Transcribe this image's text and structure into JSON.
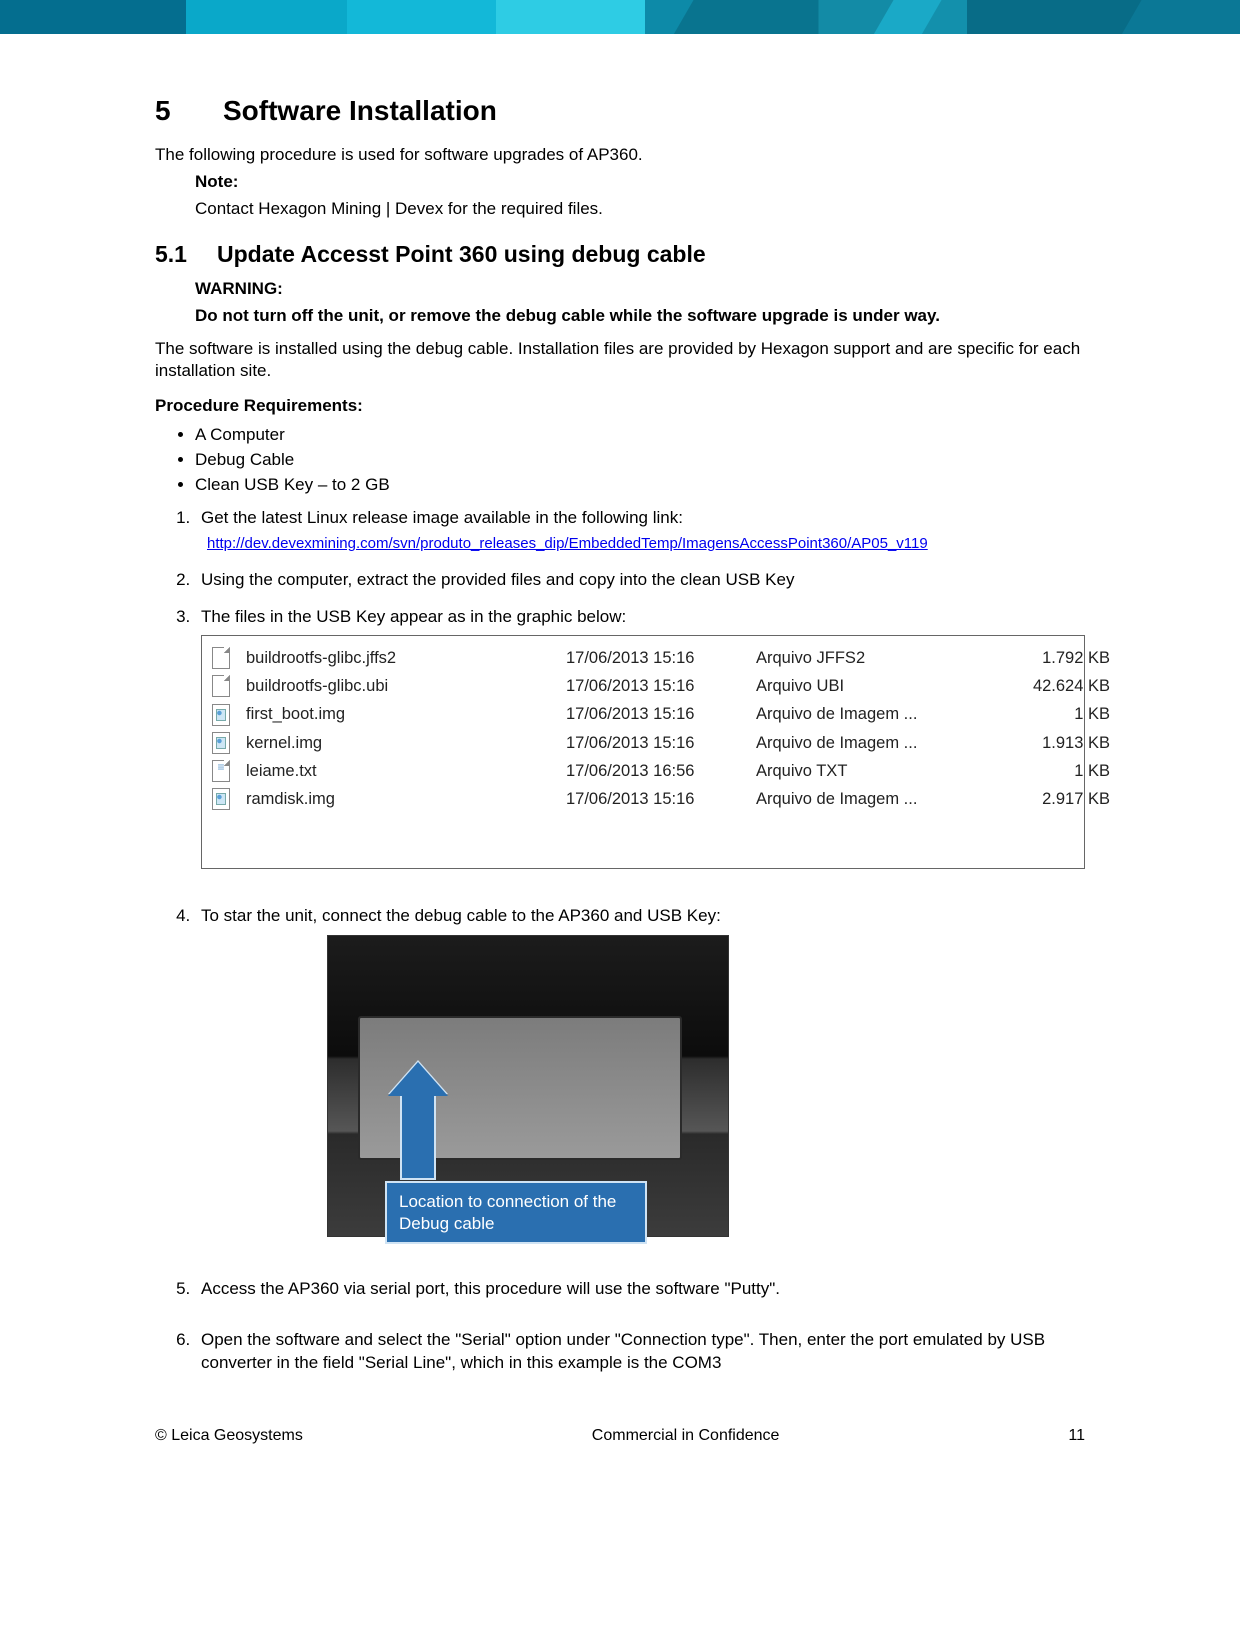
{
  "heading": {
    "num": "5",
    "title": "Software Installation"
  },
  "intro": "The following procedure is used for software upgrades of AP360.",
  "note": {
    "label": "Note:",
    "text": "Contact Hexagon Mining | Devex for the required files."
  },
  "subheading": {
    "num": "5.1",
    "title": "Update Accesst Point 360 using debug cable"
  },
  "warning": {
    "label": "WARNING:",
    "text": "Do not turn off the unit, or remove the debug cable while the software upgrade is under way."
  },
  "para2": "The software is installed using the debug cable. Installation files are provided by Hexagon support and are specific for each installation site.",
  "reqLabel": "Procedure Requirements:",
  "reqs": [
    "A Computer",
    "Debug Cable",
    "Clean USB Key – to 2 GB"
  ],
  "steps": {
    "s1": "Get the latest Linux release image available in the following link:",
    "s1link": "http://dev.devexmining.com/svn/produto_releases_dip/EmbeddedTemp/ImagensAccessPoint360/AP05_v119",
    "s2": "Using the computer, extract the provided files and copy into the clean USB Key",
    "s3": "The files in the USB Key appear as in the graphic below:",
    "s4": "To star the unit, connect the debug cable to the AP360 and USB Key:",
    "s5": "Access the AP360 via serial port, this procedure will use the software \"Putty\".",
    "s6": "Open the software and select the \"Serial\" option under \"Connection type\". Then, enter the port emulated by USB converter in the field \"Serial Line\", which in this example is the COM3"
  },
  "files": [
    {
      "icon": "blank",
      "name": "buildrootfs-glibc.jffs2",
      "date": "17/06/2013 15:16",
      "type": "Arquivo JFFS2",
      "size": "1.792 KB"
    },
    {
      "icon": "blank",
      "name": "buildrootfs-glibc.ubi",
      "date": "17/06/2013 15:16",
      "type": "Arquivo UBI",
      "size": "42.624 KB"
    },
    {
      "icon": "img",
      "name": "first_boot.img",
      "date": "17/06/2013 15:16",
      "type": "Arquivo de Imagem ...",
      "size": "1 KB"
    },
    {
      "icon": "img",
      "name": "kernel.img",
      "date": "17/06/2013 15:16",
      "type": "Arquivo de Imagem ...",
      "size": "1.913 KB"
    },
    {
      "icon": "txt",
      "name": "leiame.txt",
      "date": "17/06/2013 16:56",
      "type": "Arquivo TXT",
      "size": "1 KB"
    },
    {
      "icon": "img",
      "name": "ramdisk.img",
      "date": "17/06/2013 15:16",
      "type": "Arquivo de Imagem ...",
      "size": "2.917 KB"
    }
  ],
  "callout": "Location to connection of the Debug cable",
  "footer": {
    "left": "© Leica Geosystems",
    "center": "Commercial in Confidence",
    "right": "11"
  }
}
